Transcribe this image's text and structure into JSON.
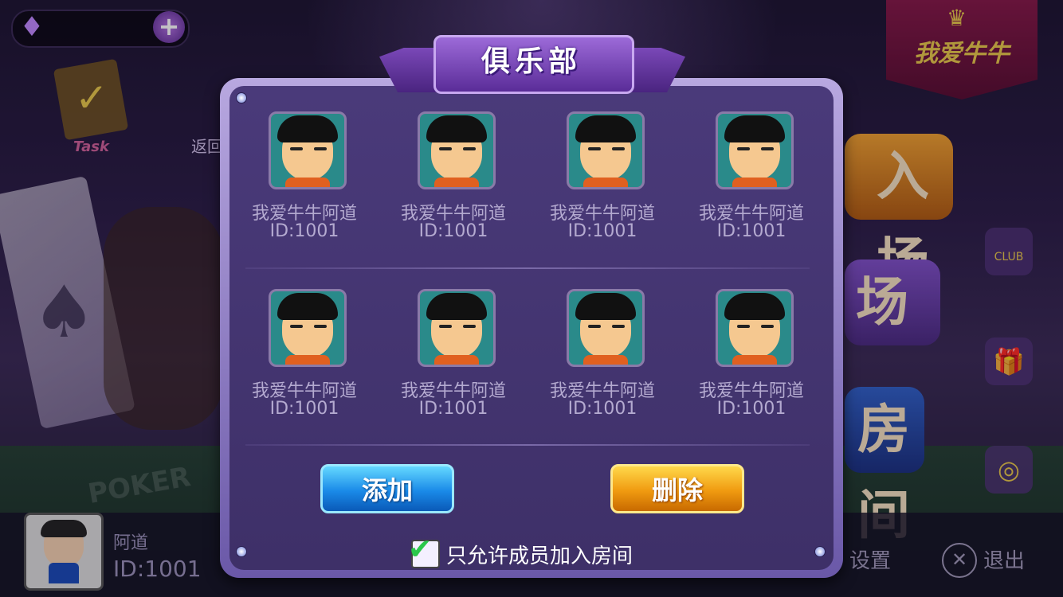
{
  "background": {
    "task_label": "Task",
    "return_label": "返回",
    "brand_text": "我爱牛牛",
    "room_buttons": [
      "入场",
      "场",
      "房间"
    ],
    "side_icons": [
      "club-icon",
      "gift-icon",
      "wheel-icon"
    ],
    "club_icon_text": "CLUB",
    "user": {
      "name": "阿道",
      "id": "ID:1001"
    },
    "settings_label": "设置",
    "exit_label": "退出",
    "table_text": "POKER"
  },
  "modal": {
    "title": "俱乐部",
    "members": [
      {
        "name": "我爱牛牛阿道",
        "id": "ID:1001"
      },
      {
        "name": "我爱牛牛阿道",
        "id": "ID:1001"
      },
      {
        "name": "我爱牛牛阿道",
        "id": "ID:1001"
      },
      {
        "name": "我爱牛牛阿道",
        "id": "ID:1001"
      },
      {
        "name": "我爱牛牛阿道",
        "id": "ID:1001"
      },
      {
        "name": "我爱牛牛阿道",
        "id": "ID:1001"
      },
      {
        "name": "我爱牛牛阿道",
        "id": "ID:1001"
      },
      {
        "name": "我爱牛牛阿道",
        "id": "ID:1001"
      }
    ],
    "add_button": "添加",
    "delete_button": "删除",
    "members_only_checkbox": {
      "label": "只允许成员加入房间",
      "checked": true
    }
  },
  "colors": {
    "add": "#1a8ae8",
    "delete": "#f09a10",
    "panel": "#4a3a7a"
  }
}
